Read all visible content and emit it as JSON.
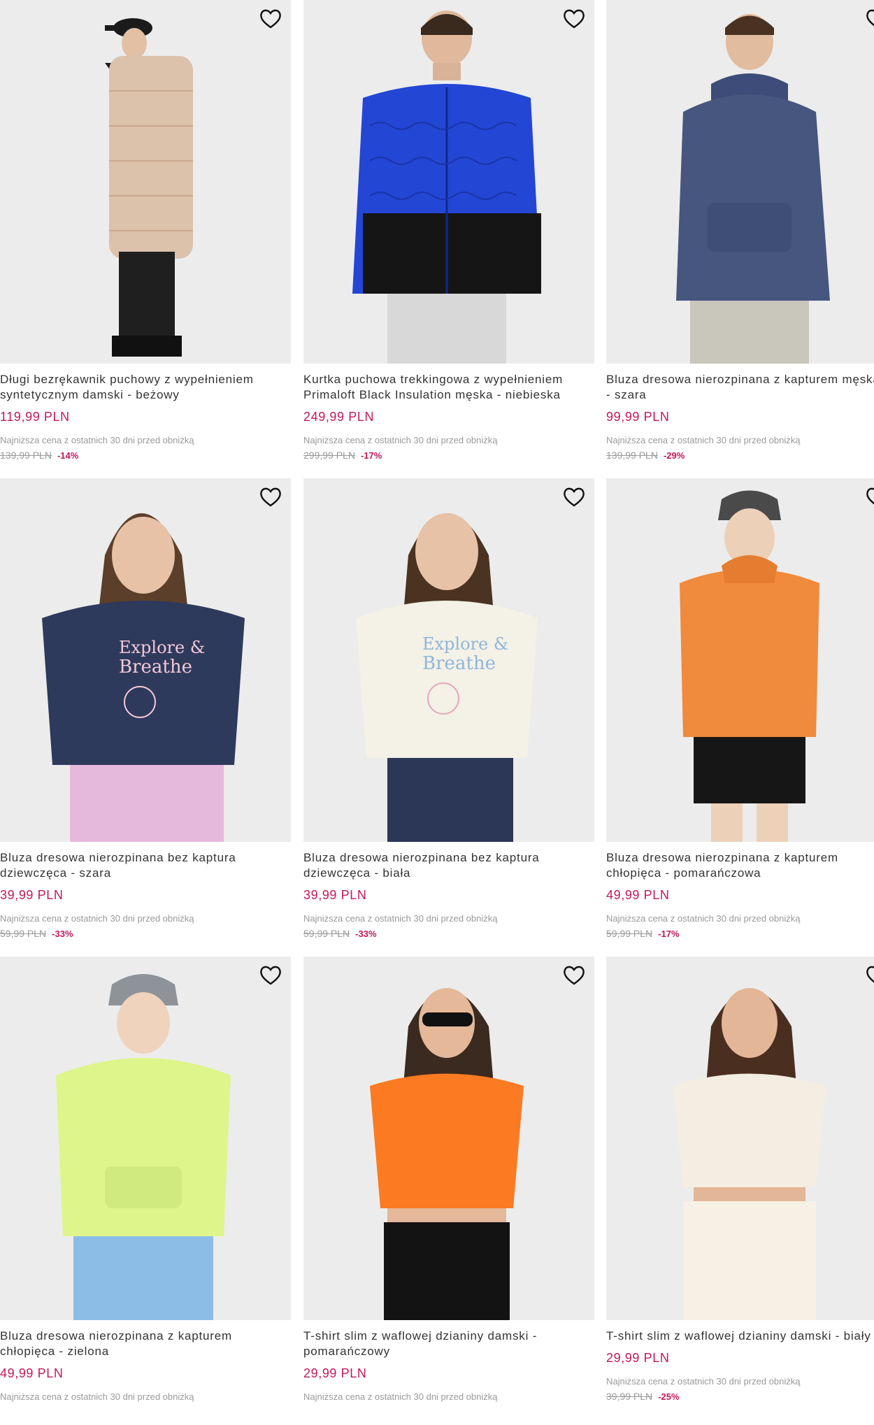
{
  "products": [
    {
      "title_line1": "Długi bezrękawnik puchowy z wypełnieniem",
      "title_line2": "syntetycznym damski - beżowy",
      "price": "119,99 PLN",
      "lowest_note": "Najniższa cena z ostatnich 30 dni przed obniżką",
      "old_price": "139,99 PLN",
      "discount": "-14%"
    },
    {
      "title_line1": "Kurtka puchowa trekkingowa z wypełnieniem",
      "title_line2": "Primaloft Black Insulation męska - niebieska",
      "price": "249,99 PLN",
      "lowest_note": "Najniższa cena z ostatnich 30 dni przed obniżką",
      "old_price": "299,99 PLN",
      "discount": "-17%"
    },
    {
      "title_line1": "Bluza dresowa nierozpinana z kapturem męska",
      "title_line2": "- szara",
      "price": "99,99 PLN",
      "lowest_note": "Najniższa cena z ostatnich 30 dni przed obniżką",
      "old_price": "139,99 PLN",
      "discount": "-29%"
    },
    {
      "title_line1": "Bluza dresowa nierozpinana bez kaptura",
      "title_line2": "dziewczęca - szara",
      "price": "39,99 PLN",
      "lowest_note": "Najniższa cena z ostatnich 30 dni przed obniżką",
      "old_price": "59,99 PLN",
      "discount": "-33%"
    },
    {
      "title_line1": "Bluza dresowa nierozpinana bez kaptura",
      "title_line2": "dziewczęca - biała",
      "price": "39,99 PLN",
      "lowest_note": "Najniższa cena z ostatnich 30 dni przed obniżką",
      "old_price": "59,99 PLN",
      "discount": "-33%"
    },
    {
      "title_line1": "Bluza dresowa nierozpinana z kapturem",
      "title_line2": "chłopięca - pomarańczowa",
      "price": "49,99 PLN",
      "lowest_note": "Najniższa cena z ostatnich 30 dni przed obniżką",
      "old_price": "59,99 PLN",
      "discount": "-17%"
    },
    {
      "title_line1": "Bluza dresowa nierozpinana z kapturem",
      "title_line2": "chłopięca - zielona",
      "price": "49,99 PLN",
      "lowest_note": "Najniższa cena z ostatnich 30 dni przed obniżką",
      "old_price": "",
      "discount": ""
    },
    {
      "title_line1": "T-shirt slim z waflowej dzianiny damski -",
      "title_line2": "pomarańczowy",
      "price": "29,99 PLN",
      "lowest_note": "Najniższa cena z ostatnich 30 dni przed obniżką",
      "old_price": "",
      "discount": ""
    },
    {
      "title_line1": "T-shirt slim z waflowej dzianiny damski - biały",
      "title_line2": "",
      "price": "29,99 PLN",
      "lowest_note": "Najniższa cena z ostatnich 30 dni przed obniżką",
      "old_price": "39,99 PLN",
      "discount": "-25%"
    }
  ],
  "print_text": {
    "line1": "Explore &",
    "line2": "Breathe"
  },
  "colors": {
    "price": "#c2185b",
    "muted": "#9a9a9a",
    "photo_bg": "#ececec",
    "title": "#333333"
  },
  "icons": {
    "favorite": "heart-outline-icon"
  }
}
